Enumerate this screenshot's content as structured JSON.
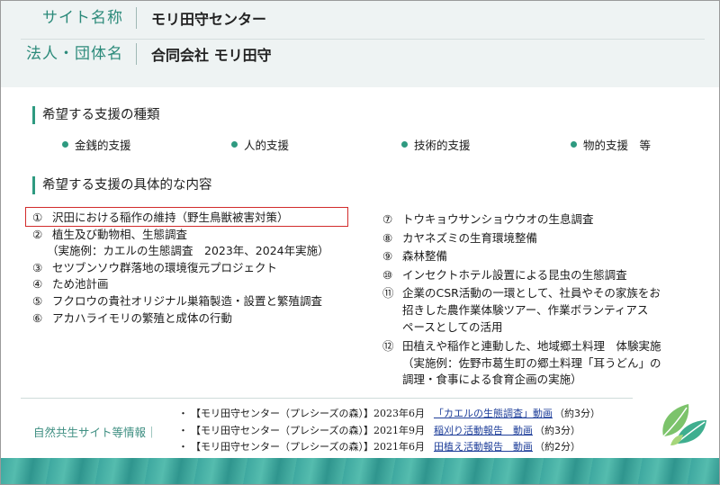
{
  "header": {
    "site_name_label": "サイト名称",
    "site_name_value": "モリ田守センター",
    "org_label": "法人・団体名",
    "org_value": "合同会社 モリ田守"
  },
  "support_types": {
    "title": "希望する支援の種類",
    "items": [
      "金銭的支援",
      "人的支援",
      "技術的支援",
      "物的支援　等"
    ]
  },
  "support_details": {
    "title": "希望する支援の具体的な内容",
    "left": [
      {
        "num": "①",
        "lines": [
          "沢田における稲作の維持（野生鳥獣被害対策）"
        ]
      },
      {
        "num": "②",
        "lines": [
          "植生及び動物相、生態調査",
          "（実施例：カエルの生態調査　2023年、2024年実施）"
        ]
      },
      {
        "num": "③",
        "lines": [
          "セツブンソウ群落地の環境復元プロジェクト"
        ]
      },
      {
        "num": "④",
        "lines": [
          "ため池計画"
        ]
      },
      {
        "num": "⑤",
        "lines": [
          "フクロウの貴社オリジナル巣箱製造・設置と繁殖調査"
        ]
      },
      {
        "num": "⑥",
        "lines": [
          "アカハライモリの繁殖と成体の行動"
        ]
      }
    ],
    "right": [
      {
        "num": "⑦",
        "lines": [
          "トウキョウサンショウウオの生息調査"
        ]
      },
      {
        "num": "⑧",
        "lines": [
          "カヤネズミの生育環境整備"
        ]
      },
      {
        "num": "⑨",
        "lines": [
          "森林整備"
        ]
      },
      {
        "num": "⑩",
        "lines": [
          "インセクトホテル設置による昆虫の生態調査"
        ]
      },
      {
        "num": "⑪",
        "lines": [
          "企業のCSR活動の一環として、社員やその家族をお",
          "招きした農作業体験ツアー、作業ボランティアス",
          "ペースとしての活用"
        ]
      },
      {
        "num": "⑫",
        "lines": [
          "田植えや稲作と連動した、地域郷土料理　体験実施",
          "（実施例：佐野市葛生町の郷土料理「耳うどん」の",
          "調理・食事による食育企画の実施）"
        ]
      }
    ]
  },
  "nature_info": {
    "label": "自然共生サイト等情報｜",
    "links": [
      {
        "bullet": "・",
        "text": "【モリ田守センター（プレシーズの森）】2023年6月",
        "link": "「カエルの生態調査」動画",
        "after": "（約3分）"
      },
      {
        "bullet": "・",
        "text": "【モリ田守センター（プレシーズの森）】2021年9月",
        "link": "稲刈り活動報告　動画",
        "after": "（約3分）"
      },
      {
        "bullet": "・",
        "text": "【モリ田守センター（プレシーズの森）】2021年6月",
        "link": "田植え活動報告　動画",
        "after": "（約2分）"
      }
    ]
  },
  "colors": {
    "accent": "#2e9a80",
    "header_bg": "#eef3f3",
    "highlight": "#d22b2b",
    "link": "#1f3f9a"
  },
  "icons": {
    "leaves": "leaves-icon"
  }
}
